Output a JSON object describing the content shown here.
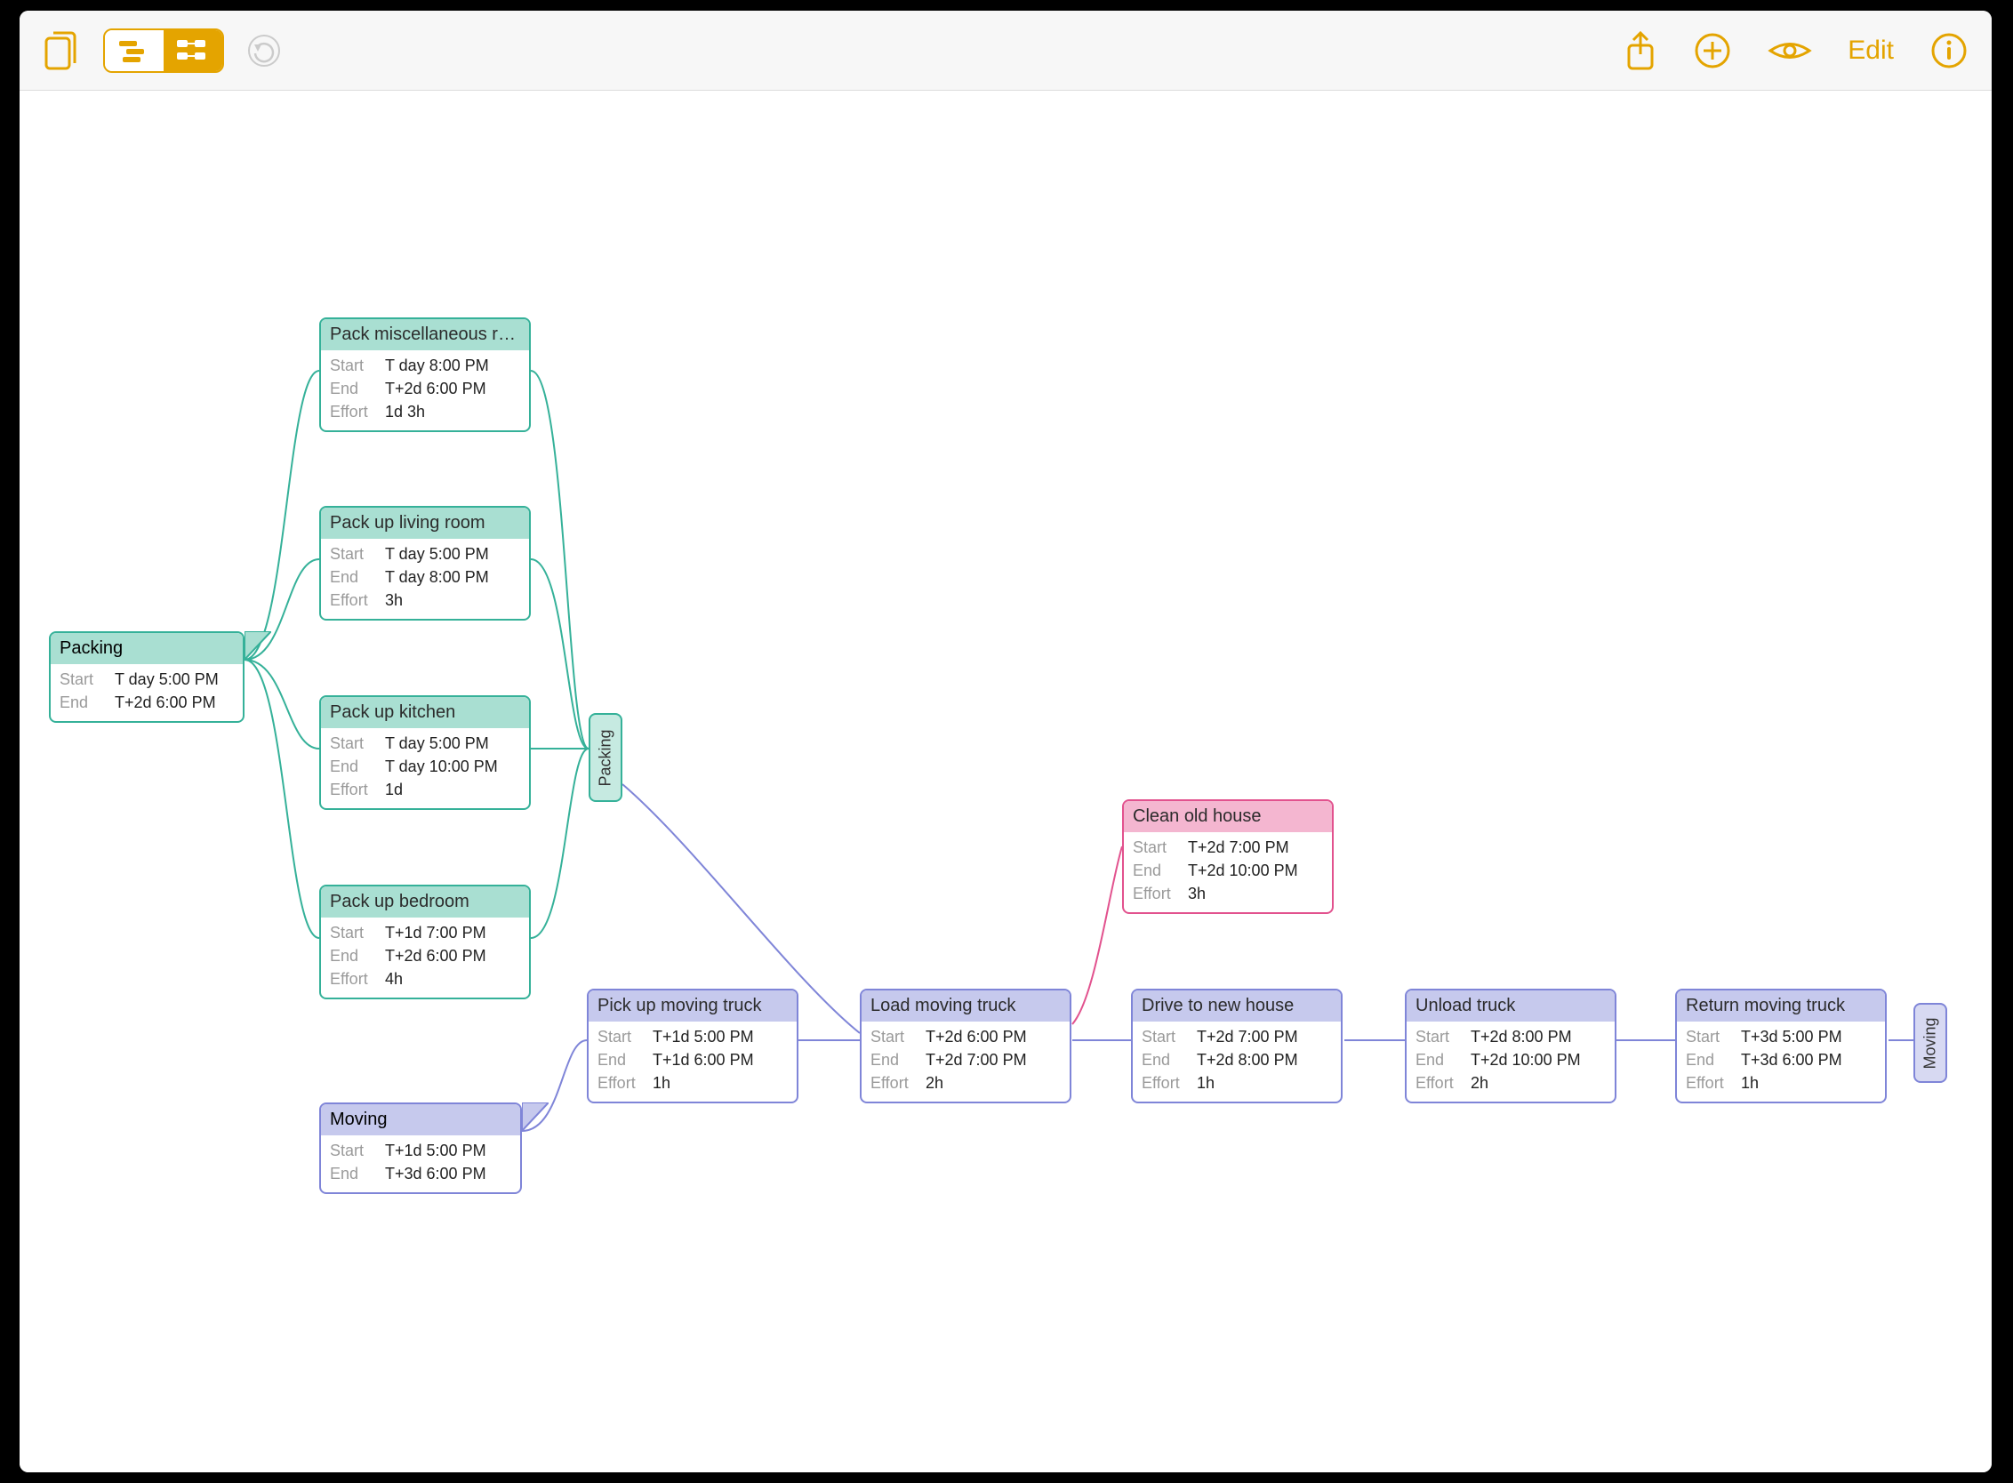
{
  "toolbar": {
    "edit_label": "Edit"
  },
  "labels": {
    "start": "Start",
    "end": "End",
    "effort": "Effort"
  },
  "groups": {
    "packing": {
      "title": "Packing",
      "start": "T day 5:00 PM",
      "end": "T+2d 6:00 PM",
      "pill": "Packing"
    },
    "moving": {
      "title": "Moving",
      "start": "T+1d 5:00 PM",
      "end": "T+3d 6:00 PM",
      "pill": "Moving"
    }
  },
  "tasks": {
    "pack_misc": {
      "title": "Pack miscellaneous ro…",
      "start": "T day 8:00 PM",
      "end": "T+2d 6:00 PM",
      "effort": "1d 3h"
    },
    "pack_living": {
      "title": "Pack up living room",
      "start": "T day 5:00 PM",
      "end": "T day 8:00 PM",
      "effort": "3h"
    },
    "pack_kitchen": {
      "title": "Pack up kitchen",
      "start": "T day 5:00 PM",
      "end": "T day 10:00 PM",
      "effort": "1d"
    },
    "pack_bedroom": {
      "title": "Pack up bedroom",
      "start": "T+1d 7:00 PM",
      "end": "T+2d 6:00 PM",
      "effort": "4h"
    },
    "clean": {
      "title": "Clean old house",
      "start": "T+2d 7:00 PM",
      "end": "T+2d 10:00 PM",
      "effort": "3h"
    },
    "pickup": {
      "title": "Pick up moving truck",
      "start": "T+1d 5:00 PM",
      "end": "T+1d 6:00 PM",
      "effort": "1h"
    },
    "load": {
      "title": "Load moving truck",
      "start": "T+2d 6:00 PM",
      "end": "T+2d 7:00 PM",
      "effort": "2h"
    },
    "drive": {
      "title": "Drive to new house",
      "start": "T+2d 7:00 PM",
      "end": "T+2d 8:00 PM",
      "effort": "1h"
    },
    "unload": {
      "title": "Unload truck",
      "start": "T+2d 8:00 PM",
      "end": "T+2d 10:00 PM",
      "effort": "2h"
    },
    "return": {
      "title": "Return moving truck",
      "start": "T+3d 5:00 PM",
      "end": "T+3d 6:00 PM",
      "effort": "1h"
    }
  }
}
